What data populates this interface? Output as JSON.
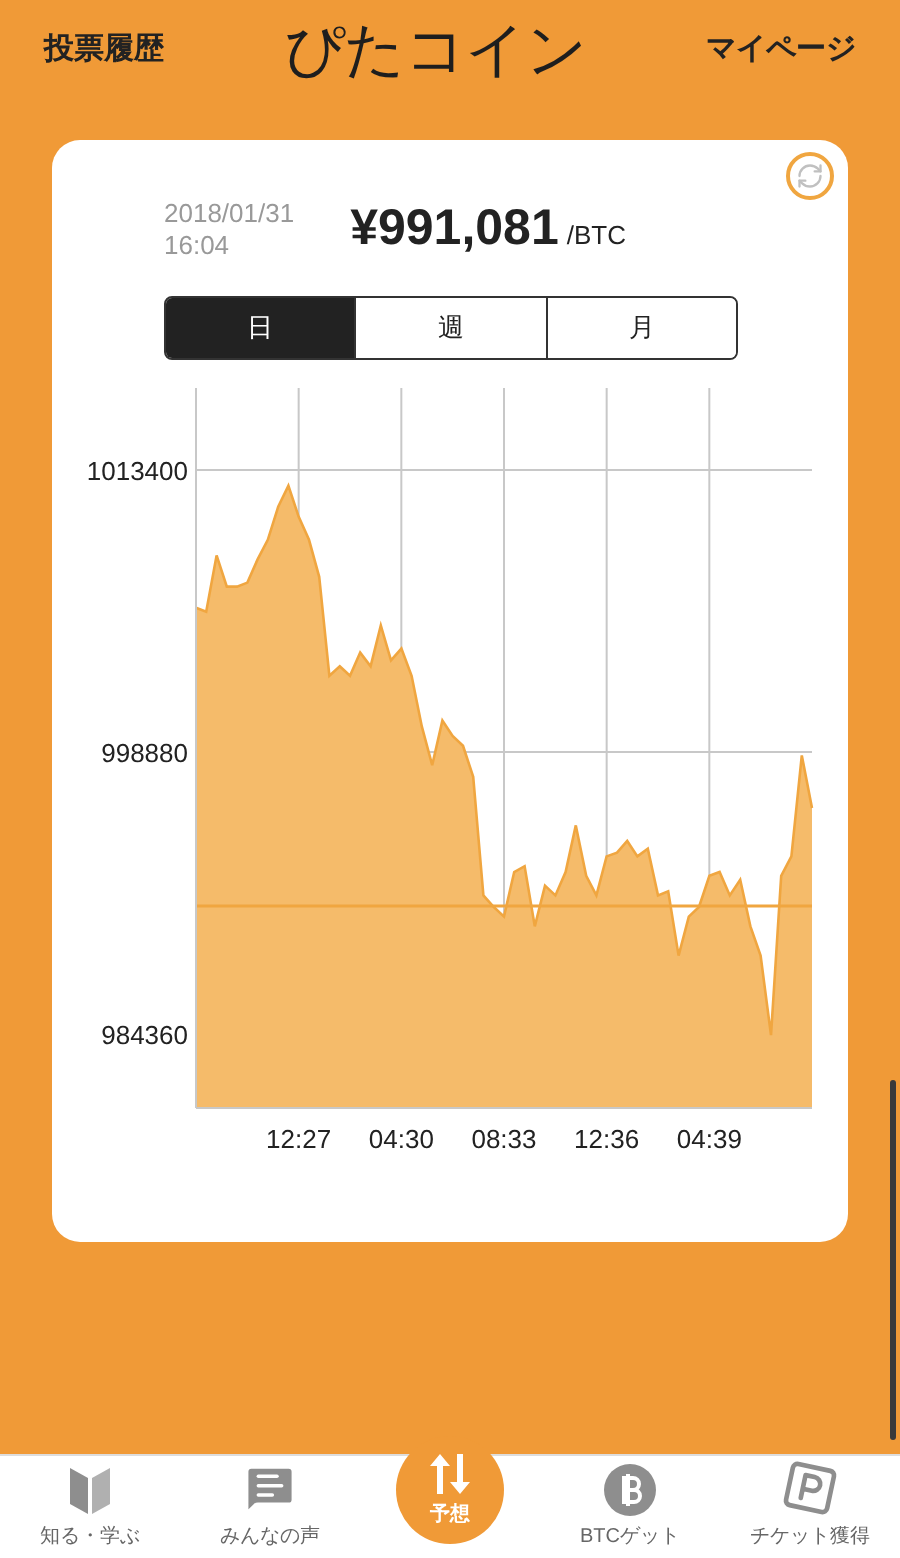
{
  "header": {
    "left_link": "投票履歴",
    "logo": "ぴたコイン",
    "right_link": "マイページ"
  },
  "price_card": {
    "date": "2018/01/31",
    "time": "16:04",
    "price": "¥991,081",
    "unit": "/BTC",
    "periods": [
      {
        "label": "日",
        "selected": true
      },
      {
        "label": "週",
        "selected": false
      },
      {
        "label": "月",
        "selected": false
      }
    ],
    "chart_data": {
      "type": "area",
      "categories": [
        null,
        null,
        null,
        null,
        null,
        null,
        null,
        null,
        null,
        null,
        "12:27",
        null,
        null,
        null,
        null,
        null,
        null,
        null,
        null,
        null,
        "04:30",
        null,
        null,
        null,
        null,
        null,
        null,
        null,
        null,
        null,
        "08:33",
        null,
        null,
        null,
        null,
        null,
        null,
        null,
        null,
        null,
        "12:36",
        null,
        null,
        null,
        null,
        null,
        null,
        null,
        null,
        null,
        "04:39",
        null,
        null,
        null,
        null,
        null,
        null,
        null,
        null,
        null,
        null
      ],
      "series": [
        {
          "color": "#f0a640",
          "values": [
            1006300,
            1006100,
            1009000,
            1007400,
            1007400,
            1007600,
            1008800,
            1009800,
            1011500,
            1012600,
            1011000,
            1009800,
            1007900,
            1002800,
            1003300,
            1002800,
            1004000,
            1003300,
            1005400,
            1003600,
            1004200,
            1002800,
            1000200,
            998200,
            1000500,
            999700,
            999200,
            997600,
            991500,
            990900,
            990400,
            992700,
            993000,
            989900,
            992000,
            991500,
            992700,
            995100,
            992500,
            991500,
            993500,
            993700,
            994300,
            993500,
            993900,
            991500,
            991700,
            988400,
            990400,
            990900,
            992500,
            992700,
            991500,
            992300,
            989900,
            988400,
            984300,
            992500,
            993500,
            998700,
            996000
          ]
        }
      ],
      "ylim": [
        980550,
        1017620
      ],
      "yticks": [
        984360,
        998880,
        1013400
      ],
      "grid": true,
      "ref_lines": [
        {
          "axis": "y",
          "value": 990950
        }
      ]
    }
  },
  "tab_bar": [
    {
      "label": "知る・学ぶ",
      "kind": "beginner",
      "selected": false
    },
    {
      "label": "みんなの声",
      "kind": "chat",
      "selected": false
    },
    {
      "label": "予想",
      "kind": "forecast",
      "selected": true
    },
    {
      "label": "BTCゲット",
      "kind": "bitcoin",
      "selected": false
    },
    {
      "label": "チケット獲得",
      "kind": "ticket",
      "selected": false
    }
  ]
}
